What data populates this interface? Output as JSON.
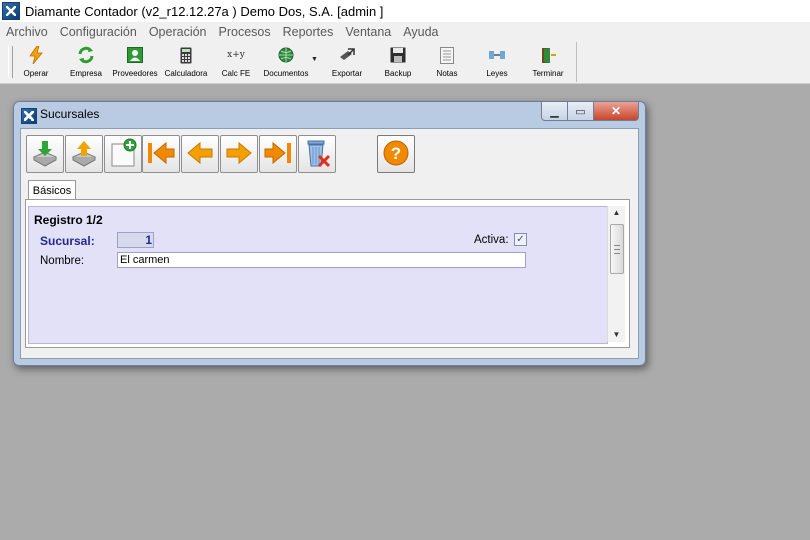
{
  "app": {
    "title": "Diamante Contador (v2_r12.12.27a ) Demo Dos, S.A.  [admin ]"
  },
  "menu": [
    "Archivo",
    "Configuración",
    "Operación",
    "Procesos",
    "Reportes",
    "Ventana",
    "Ayuda"
  ],
  "toolbar": {
    "operar": "Operar",
    "empresa": "Empresa",
    "proveedores": "Proveedores",
    "calculadora": "Calculadora",
    "calcfe": "Calc FE",
    "documentos": "Documentos",
    "exportar": "Exportar",
    "backup": "Backup",
    "notas": "Notas",
    "leyes": "Leyes",
    "terminar": "Terminar"
  },
  "dialog": {
    "title": "Sucursales",
    "tab": "Básicos",
    "record": "Registro 1/2",
    "sucursal_label": "Sucursal:",
    "sucursal_value": "1",
    "activa_label": "Activa:",
    "activa_checked": true,
    "nombre_label": "Nombre:",
    "nombre_value": "El carmen"
  },
  "colors": {
    "background": "#ababab",
    "form_bg": "#e3e1f8",
    "label_blue": "#1f2a8f"
  }
}
